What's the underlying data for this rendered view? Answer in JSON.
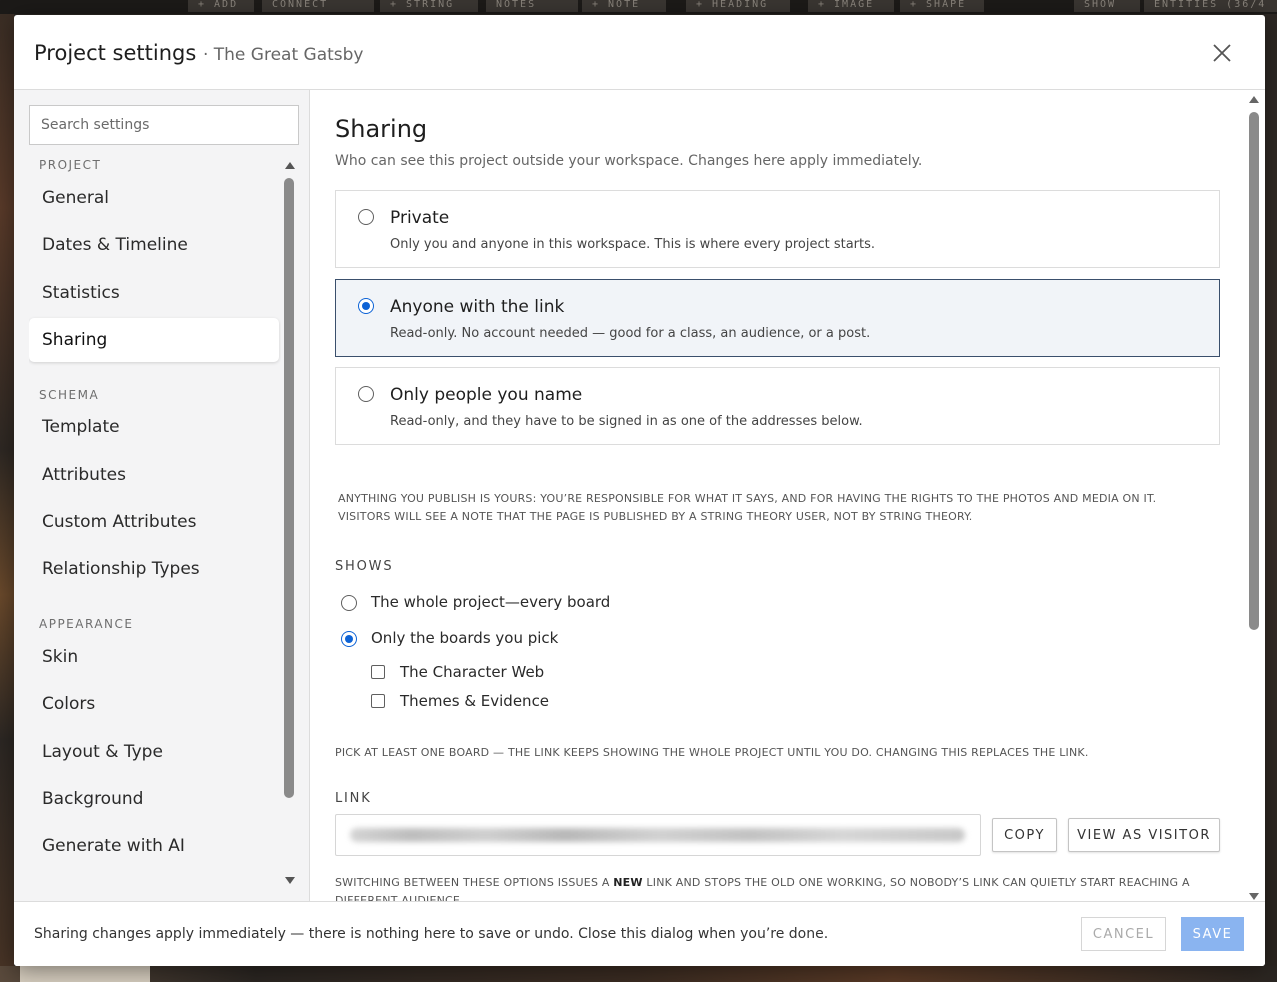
{
  "background": {
    "toolbar": [
      "+ ADD",
      "CONNECT",
      "+ STRING",
      "NOTES",
      "+ NOTE",
      "+ HEADING",
      "+ IMAGE",
      "+ SHAPE",
      "SHOW",
      "ENTITIES (36/4"
    ]
  },
  "dialog": {
    "title": "Project settings",
    "subtitle": "· The Great Gatsby",
    "close_icon": "close-icon"
  },
  "sidebar": {
    "search_placeholder": "Search settings",
    "sections": [
      {
        "label": "PROJECT",
        "items": [
          "General",
          "Dates & Timeline",
          "Statistics",
          "Sharing"
        ]
      },
      {
        "label": "SCHEMA",
        "items": [
          "Template",
          "Attributes",
          "Custom Attributes",
          "Relationship Types"
        ]
      },
      {
        "label": "APPEARANCE",
        "items": [
          "Skin",
          "Colors",
          "Layout & Type",
          "Background",
          "Generate with AI"
        ]
      }
    ],
    "active_item": "Sharing"
  },
  "content": {
    "title": "Sharing",
    "subtitle": "Who can see this project outside your workspace. Changes here apply immediately.",
    "options": [
      {
        "title": "Private",
        "description": "Only you and anyone in this workspace. This is where every project starts.",
        "selected": false
      },
      {
        "title": "Anyone with the link",
        "description": "Read-only. No account needed — good for a class, an audience, or a post.",
        "selected": true
      },
      {
        "title": "Only people you name",
        "description": "Read-only, and they have to be signed in as one of the addresses below.",
        "selected": false
      }
    ],
    "legal_line1": "Anything you publish is yours: you’re responsible for what it says, and for having the rights to the photos and media on it.",
    "legal_line2": "Visitors will see a note that the page is published by a String Theory user, not by String Theory.",
    "shows_label": "SHOWS",
    "shows_options": [
      {
        "label": "The whole project—every board",
        "selected": false
      },
      {
        "label": "Only the boards you pick",
        "selected": true
      }
    ],
    "boards": [
      {
        "label": "The Character Web",
        "checked": false
      },
      {
        "label": "Themes & Evidence",
        "checked": false
      }
    ],
    "boards_hint": "Pick at least one board — the link keeps showing the whole project until you do. Changing this replaces the link.",
    "link_label": "LINK",
    "copy_label": "COPY",
    "view_label": "VIEW AS VISITOR",
    "switch_note_pre": "Switching between these options issues a ",
    "switch_note_bold": "NEW",
    "switch_note_post": " link and stops the old one working, so nobody’s link can quietly start reaching a different audience."
  },
  "footer": {
    "text": "Sharing changes apply immediately — there is nothing here to save or undo. Close this dialog when you’re done.",
    "cancel_label": "CANCEL",
    "save_label": "SAVE"
  },
  "colors": {
    "accent": "#0d63d6",
    "selected_border": "#3a4f6c",
    "save_disabled": "#8ab4f0"
  }
}
